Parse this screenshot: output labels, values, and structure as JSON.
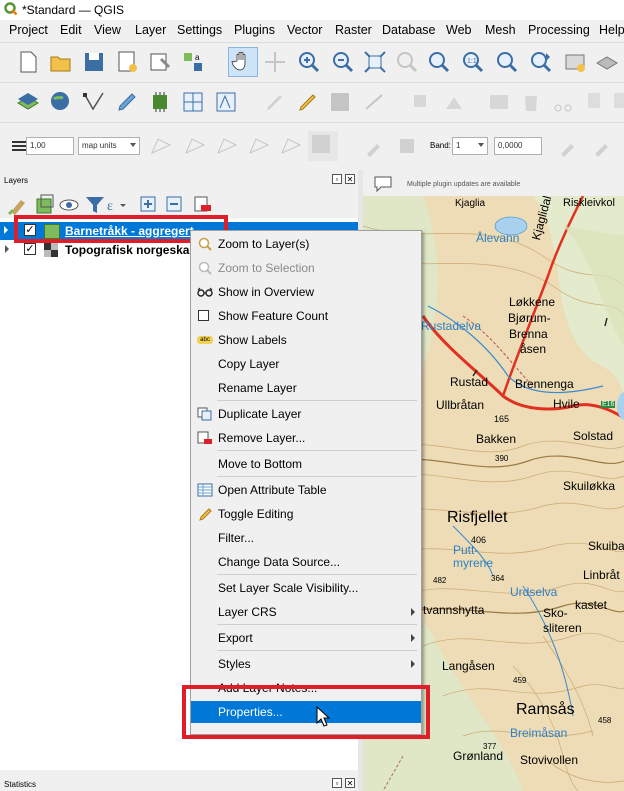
{
  "window": {
    "title": "*Standard — QGIS",
    "logo_icon": "qgis-logo-icon"
  },
  "menu": [
    "Project",
    "Edit",
    "View",
    "Layer",
    "Settings",
    "Plugins",
    "Vector",
    "Raster",
    "Database",
    "Web",
    "Mesh",
    "Processing",
    "Help"
  ],
  "toolbar3": {
    "width_value": "1,00",
    "units_value": "map units",
    "band_label": "Band:",
    "band_value": "1",
    "value_field": "0,0000"
  },
  "messagebar": {
    "text": "Multiple plugin updates are available"
  },
  "layers_panel": {
    "title": "Layers",
    "layers": [
      {
        "name": "Barnetråkk - aggregert",
        "checked": true,
        "selected": true,
        "color": "#7dbb5e"
      },
      {
        "name": "Topografisk norgeskart",
        "checked": true,
        "selected": false
      }
    ]
  },
  "statistics_panel": {
    "title": "Statistics"
  },
  "context_menu": {
    "items": [
      {
        "label": "Zoom to Layer(s)",
        "icon": "zoom-layer-icon",
        "disabled": false
      },
      {
        "label": "Zoom to Selection",
        "icon": "zoom-selection-icon",
        "disabled": true
      },
      {
        "label": "Show in Overview",
        "icon": "overview-glasses-icon",
        "disabled": false
      },
      {
        "label": "Show Feature Count",
        "icon": "checkbox-icon",
        "disabled": false
      },
      {
        "label": "Show Labels",
        "icon": "labels-abc-icon",
        "disabled": false
      },
      {
        "label": "Copy Layer",
        "icon": "",
        "disabled": false
      },
      {
        "label": "Rename Layer",
        "icon": "",
        "disabled": false
      },
      {
        "label": "Duplicate Layer",
        "icon": "duplicate-icon",
        "disabled": false
      },
      {
        "label": "Remove Layer...",
        "icon": "remove-layer-icon",
        "disabled": false
      },
      {
        "label": "Move to Bottom",
        "icon": "",
        "disabled": false
      },
      {
        "label": "Open Attribute Table",
        "icon": "attribute-table-icon",
        "disabled": false
      },
      {
        "label": "Toggle Editing",
        "icon": "pencil-icon",
        "disabled": false
      },
      {
        "label": "Filter...",
        "icon": "",
        "disabled": false
      },
      {
        "label": "Change Data Source...",
        "icon": "",
        "disabled": false
      },
      {
        "label": "Set Layer Scale Visibility...",
        "icon": "",
        "disabled": false
      },
      {
        "label": "Layer CRS",
        "icon": "",
        "disabled": false,
        "submenu": true
      },
      {
        "label": "Export",
        "icon": "",
        "disabled": false,
        "submenu": true
      },
      {
        "label": "Styles",
        "icon": "",
        "disabled": false,
        "submenu": true
      },
      {
        "label": "Add Layer Notes...",
        "icon": "",
        "disabled": false
      },
      {
        "label": "Properties...",
        "icon": "",
        "disabled": false,
        "highlighted": true
      }
    ]
  },
  "map_labels": [
    "Kjaglia",
    "Riskleivkol",
    "Ålevann",
    "Kjaglidalen",
    "Løkkene",
    "Bjørum-",
    "Brenna",
    "åsen",
    "Rustadelva",
    "Rustad",
    "Brennenga",
    "Ullbråtan",
    "Hvile",
    "E16",
    "Solstad",
    "165",
    "Bakken",
    "Skuiløkka",
    "Risfjellet",
    "406",
    "Putt-",
    "myrene",
    "Skuiba",
    "Linbråt",
    "Urdselva",
    "kastet",
    "Sko-",
    "sliteren",
    "rtvannshytta",
    "Langåsen",
    "Ramsås",
    "Breimåsan",
    "Grønland",
    "Stovivollen",
    "390",
    "364",
    "459",
    "458",
    "482",
    "377"
  ]
}
